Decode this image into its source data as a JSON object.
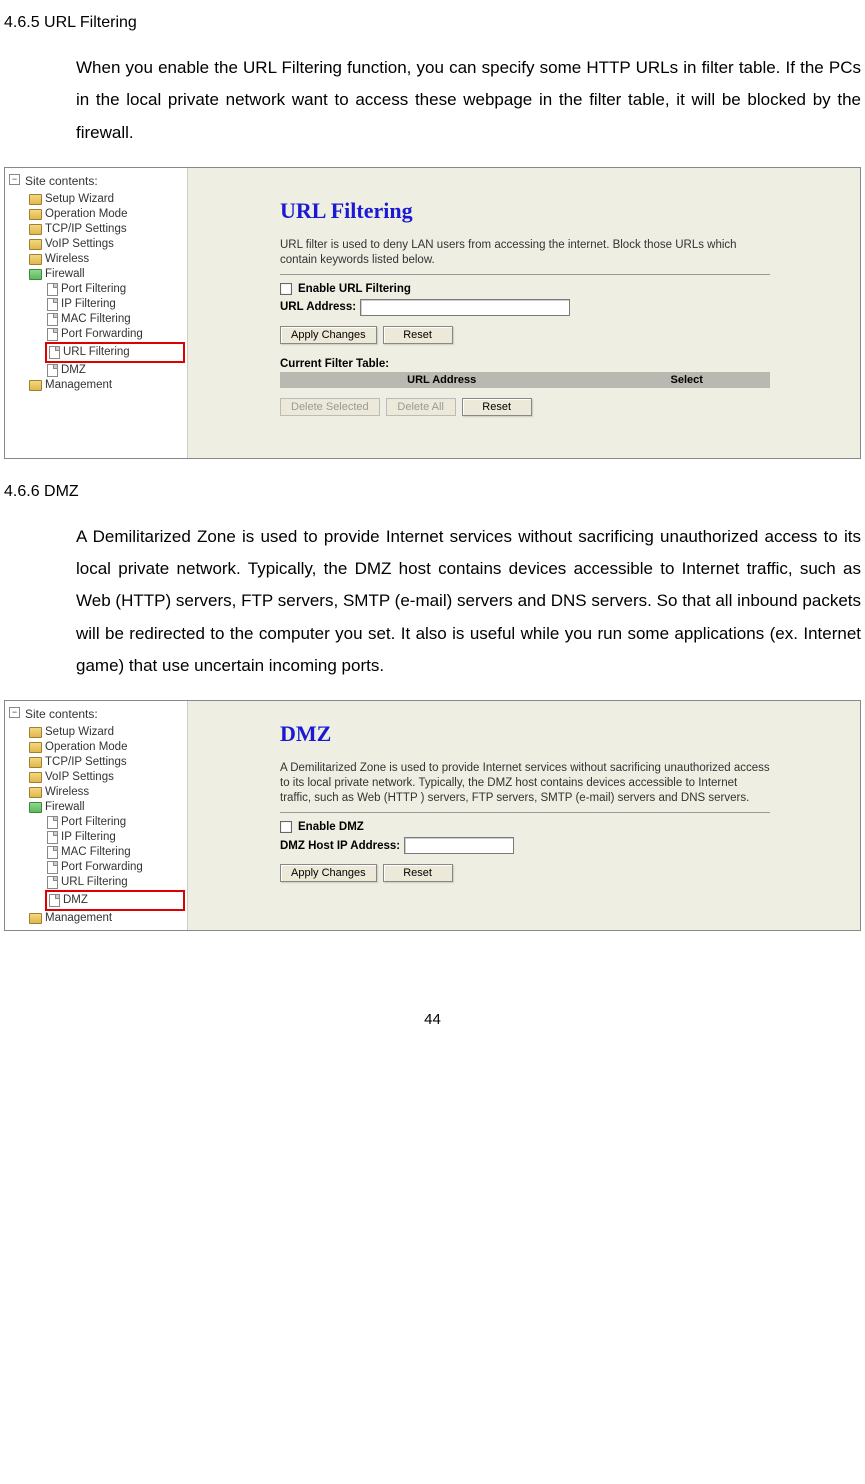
{
  "sections": {
    "url_filtering": {
      "heading": "4.6.5 URL Filtering",
      "body": "When you enable the URL Filtering function, you can specify some HTTP URLs in filter table. If the PCs in the local private network want to access these webpage in the filter table, it will be blocked by the firewall."
    },
    "dmz": {
      "heading": "4.6.6 DMZ",
      "body": "A Demilitarized Zone is used to provide Internet services without sacrificing unauthorized access to its local private network. Typically, the DMZ host contains devices accessible to Internet traffic, such as Web (HTTP) servers, FTP servers, SMTP (e-mail) servers and DNS servers. So that all inbound packets will be redirected to the computer you set. It also is useful while you run some applications (ex. Internet game) that use uncertain incoming ports."
    }
  },
  "sidebar": {
    "title": "Site contents:",
    "items": {
      "setup_wizard": "Setup Wizard",
      "operation_mode": "Operation Mode",
      "tcpip": "TCP/IP Settings",
      "voip": "VoIP Settings",
      "wireless": "Wireless",
      "firewall": "Firewall",
      "management": "Management"
    },
    "firewall_children": {
      "port_filtering": "Port Filtering",
      "ip_filtering": "IP Filtering",
      "mac_filtering": "MAC Filtering",
      "port_forwarding": "Port Forwarding",
      "url_filtering": "URL Filtering",
      "dmz": "DMZ"
    }
  },
  "url_panel": {
    "title": "URL Filtering",
    "desc": "URL filter is used to deny LAN users from accessing the internet. Block those URLs which contain keywords listed below.",
    "enable_label": "Enable URL Filtering",
    "url_label": "URL Address:",
    "apply": "Apply Changes",
    "reset": "Reset",
    "table_label": "Current Filter Table:",
    "col1": "URL Address",
    "col2": "Select",
    "delete_selected": "Delete Selected",
    "delete_all": "Delete All",
    "reset2": "Reset"
  },
  "dmz_panel": {
    "title": "DMZ",
    "desc": "A Demilitarized Zone is used to provide Internet services without sacrificing unauthorized access to its local private network. Typically, the DMZ host contains devices accessible to Internet traffic, such as Web (HTTP ) servers, FTP servers, SMTP (e-mail) servers and DNS servers.",
    "enable_label": "Enable DMZ",
    "ip_label": "DMZ Host IP Address:",
    "apply": "Apply Changes",
    "reset": "Reset"
  },
  "page_number": "44"
}
